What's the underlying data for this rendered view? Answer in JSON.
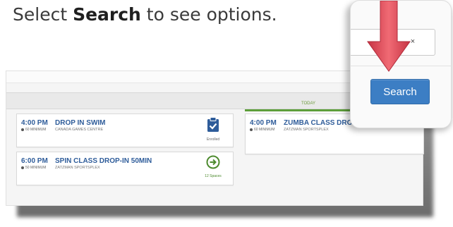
{
  "instruction": {
    "prefix": "Select ",
    "keyword": "Search",
    "suffix": " to see options."
  },
  "schedule": {
    "today_label": "TODAY",
    "events": [
      {
        "time": "4:00 PM",
        "duration": "60 MINIMUM",
        "title": "DROP IN SWIM",
        "venue": "CANADA GAMES CENTRE",
        "status": "Enrolled",
        "status_icon": "clipboard-check-icon"
      },
      {
        "time": "6:00 PM",
        "duration": "50 MINIMUM",
        "title": "SPIN CLASS DROP-IN 50MIN",
        "venue": "ZATZMAN SPORTSPLEX",
        "status": "12 Spaces",
        "status_icon": "arrow-circle-right-icon"
      },
      {
        "time": "4:00 PM",
        "duration": "60 MINIMUM",
        "title": "ZUMBA CLASS DROP-IN",
        "venue": "ZATZMAN SPORTSPLEX"
      }
    ]
  },
  "zoom_panel": {
    "clear_symbol": "×",
    "search_button_label": "Search",
    "arrow_icon": "down-arrow-icon"
  },
  "colors": {
    "title_blue": "#2e5c9a",
    "button_blue": "#3c7ec4",
    "arrow_red": "#e04a58",
    "today_green": "#5d9e3a"
  }
}
